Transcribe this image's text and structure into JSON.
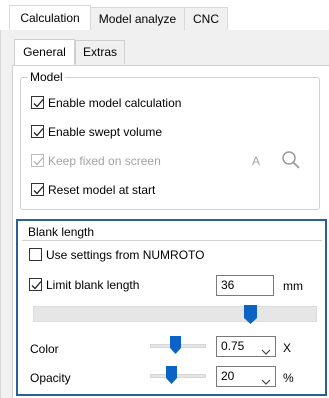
{
  "tabs": {
    "outer": [
      "Calculation",
      "Model analyze",
      "CNC"
    ],
    "inner": [
      "General",
      "Extras"
    ]
  },
  "model": {
    "title": "Model",
    "items": [
      {
        "label": "Enable model calculation",
        "checked": true,
        "enabled": true
      },
      {
        "label": "Enable swept volume",
        "checked": true,
        "enabled": true
      },
      {
        "label": "Keep fixed on screen",
        "checked": true,
        "enabled": false
      },
      {
        "label": "Reset model at start",
        "checked": true,
        "enabled": true
      }
    ],
    "keep_fixed_letter": "A"
  },
  "blank": {
    "title": "Blank length",
    "use_settings_label": "Use settings from NUMROTO",
    "use_settings_checked": false,
    "limit_label": "Limit blank length",
    "limit_checked": true,
    "length_value": "36",
    "length_unit": "mm",
    "length_slider_fraction": 0.78,
    "color_label": "Color",
    "color_value": "0.75",
    "color_unit": "X",
    "color_slider_fraction": 0.45,
    "opacity_label": "Opacity",
    "opacity_value": "20",
    "opacity_unit": "%",
    "opacity_slider_fraction": 0.35
  },
  "colors": {
    "accent": "#0b63c5",
    "group_highlight": "#2a6099"
  }
}
